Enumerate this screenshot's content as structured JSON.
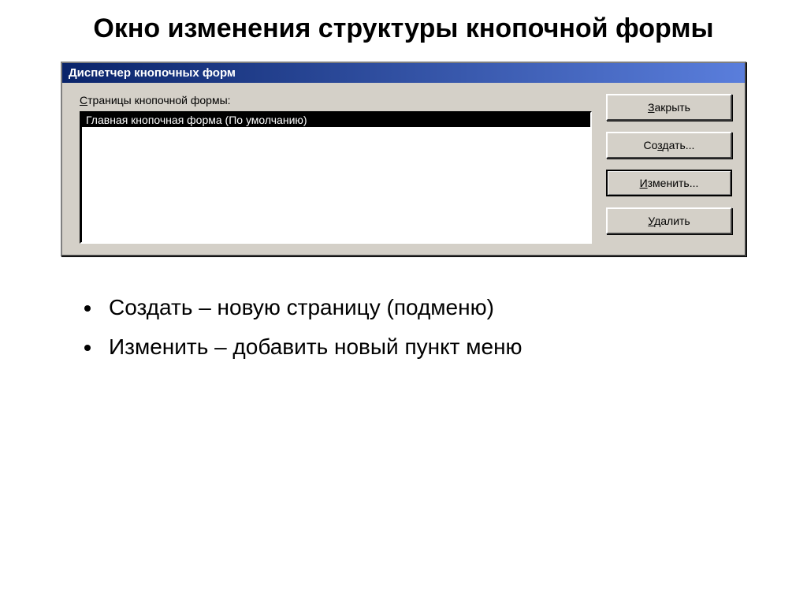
{
  "slide": {
    "title": "Окно изменения структуры кнопочной формы"
  },
  "window": {
    "title": "Диспетчер кнопочных форм",
    "panel_label_prefix": "С",
    "panel_label_rest": "траницы кнопочной формы:",
    "list_items": [
      "Главная кнопочная форма (По умолчанию)"
    ],
    "buttons": {
      "close": {
        "u": "З",
        "rest": "акрыть"
      },
      "create": {
        "prefix": "Со",
        "u": "з",
        "rest": "дать..."
      },
      "edit": {
        "u": "И",
        "rest": "зменить..."
      },
      "delete": {
        "u": "У",
        "rest": "далить"
      }
    }
  },
  "bullets": [
    "Создать – новую страницу (подменю)",
    "Изменить – добавить новый пункт меню"
  ]
}
